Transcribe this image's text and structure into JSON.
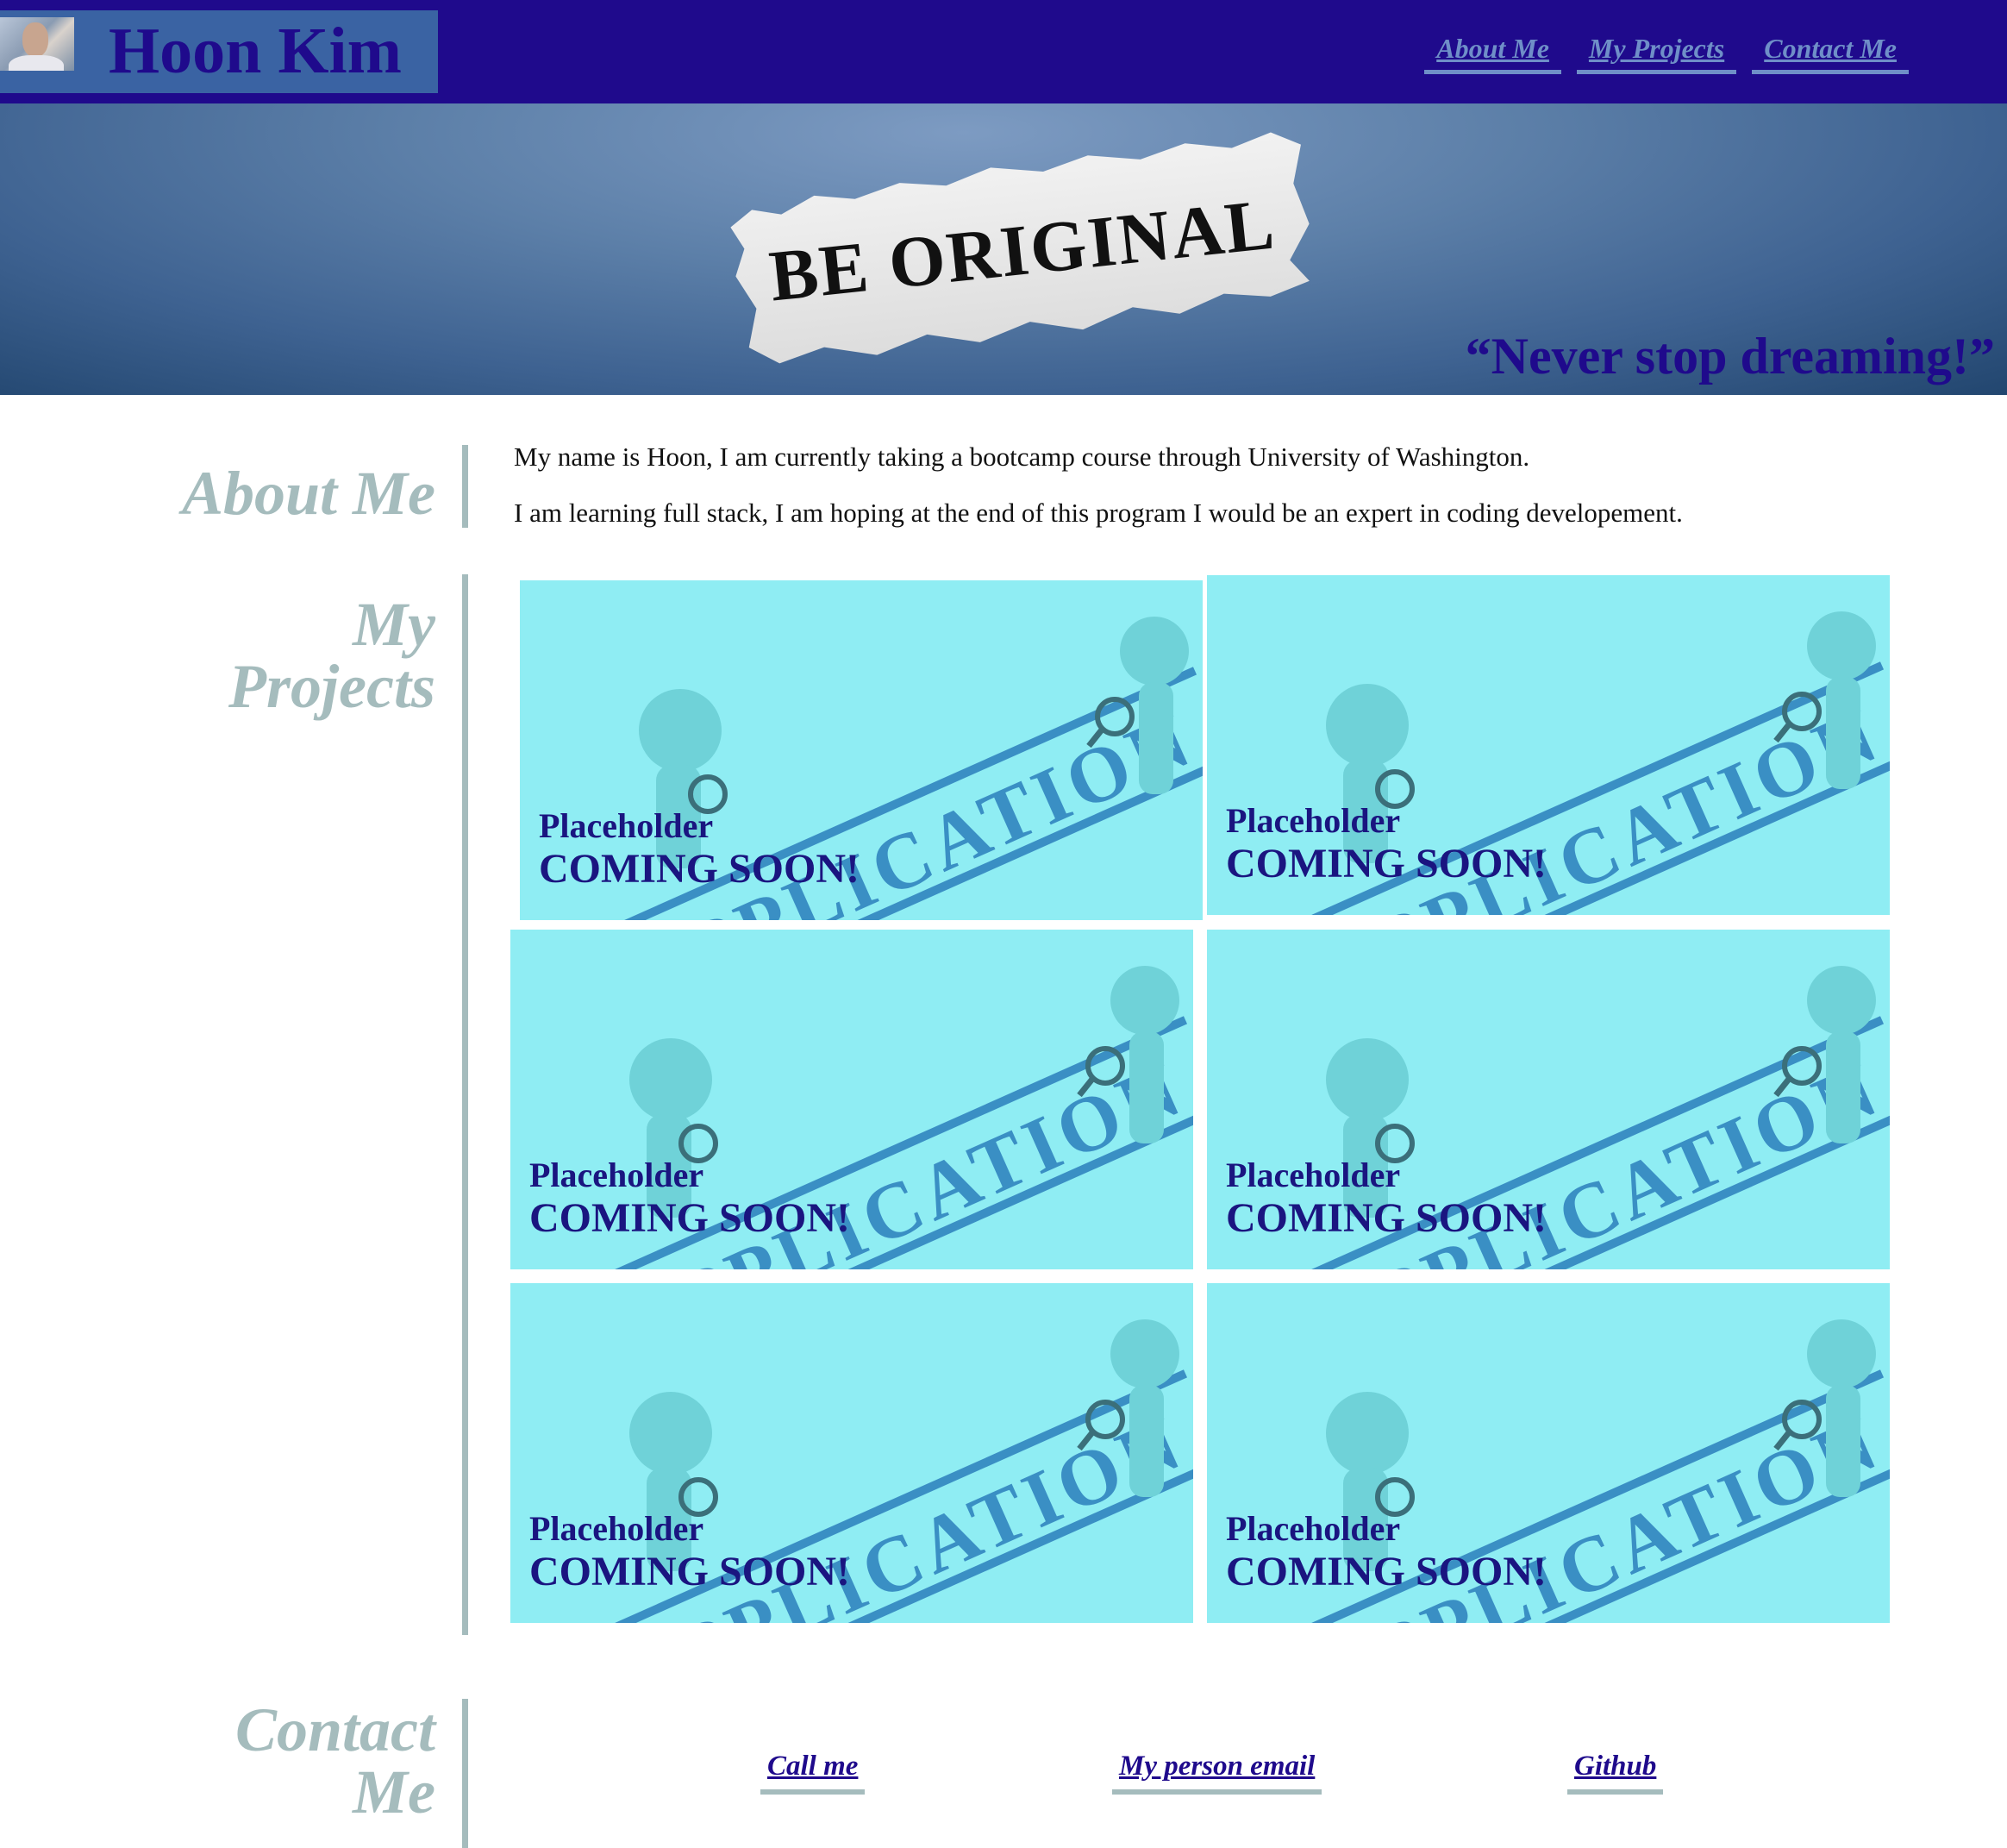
{
  "header": {
    "name": "Hoon Kim",
    "nav": [
      "About Me",
      "My Projects",
      "Contact Me"
    ]
  },
  "hero": {
    "paper_text": "BE ORIGINAL",
    "quote": "“Never stop dreaming!”"
  },
  "about": {
    "title": "About Me",
    "paragraphs": [
      "My name is Hoon, I am currently taking a bootcamp course through University of Washington.",
      "I am learning full stack, I am hoping at the end of this program I would be an expert in coding developement."
    ]
  },
  "projects": {
    "title_line1": "My",
    "title_line2": "Projects",
    "image_text": "APPLICATION",
    "cards": [
      {
        "title": "Placeholder",
        "subtitle": "COMING SOON!"
      },
      {
        "title": "Placeholder",
        "subtitle": "COMING SOON!"
      },
      {
        "title": "Placeholder",
        "subtitle": "COMING SOON!"
      },
      {
        "title": "Placeholder",
        "subtitle": "COMING SOON!"
      },
      {
        "title": "Placeholder",
        "subtitle": "COMING SOON!"
      },
      {
        "title": "Placeholder",
        "subtitle": "COMING SOON!"
      }
    ]
  },
  "contact": {
    "title_line1": "Contact",
    "title_line2": "Me",
    "links": [
      "Call me",
      "My person email",
      "Github"
    ]
  },
  "colors": {
    "header_bg": "#1f0a8c",
    "accent": "#a5bcbd",
    "card_bg": "#8fedf3",
    "card_text": "#1a1580"
  }
}
